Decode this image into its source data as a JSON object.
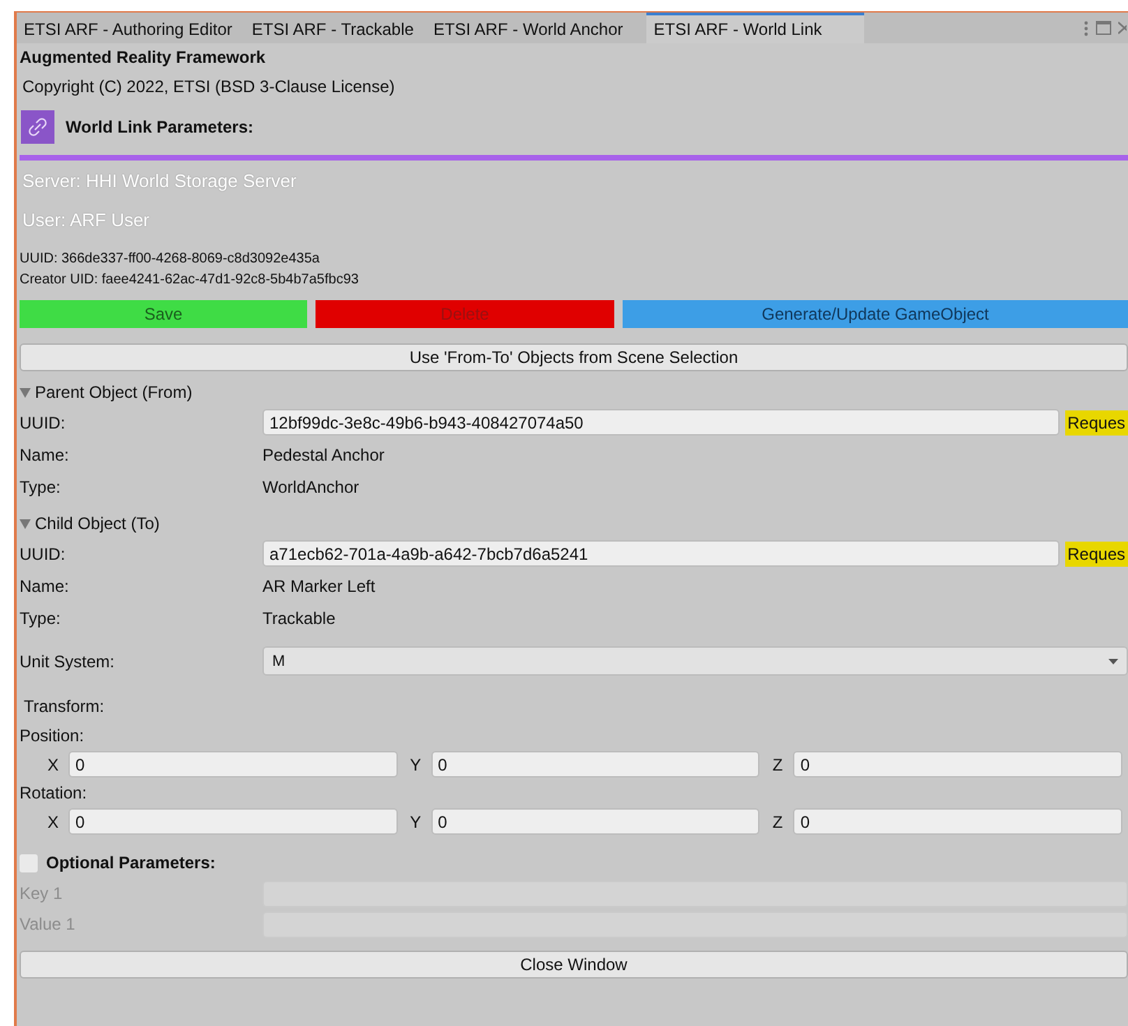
{
  "tabs": [
    {
      "label": "ETSI ARF - Authoring Editor",
      "selected": false
    },
    {
      "label": "ETSI ARF - Trackable",
      "selected": false
    },
    {
      "label": "ETSI ARF - World Anchor",
      "selected": false
    },
    {
      "label": "ETSI ARF - World Link",
      "selected": true
    }
  ],
  "title": "Augmented Reality Framework",
  "copyright": "Copyright (C) 2022, ETSI (BSD 3-Clause License)",
  "header": "World Link Parameters:",
  "server": "Server: HHI World Storage Server",
  "user": "User: ARF User",
  "uuid": "UUID: 366de337-ff00-4268-8069-c8d3092e435a",
  "creator_uid": "Creator UID: faee4241-62ac-47d1-92c8-5b4b7a5fbc93",
  "actions": [
    {
      "label": "Save",
      "kind": "save"
    },
    {
      "label": "Delete",
      "kind": "delete"
    },
    {
      "label": "Generate/Update GameObject",
      "kind": "generate"
    }
  ],
  "scene_button": "Use 'From-To' Objects from Scene Selection",
  "objects": [
    {
      "title": "Parent Object (From)",
      "expanded": true,
      "uuid_label": "UUID:",
      "uuid": "12bf99dc-3e8c-49b6-b943-408427074a50",
      "request": "Reques",
      "name_label": "Name:",
      "name": "Pedestal Anchor",
      "type_label": "Type:",
      "type": "WorldAnchor"
    },
    {
      "title": "Child Object (To)",
      "expanded": true,
      "uuid_label": "UUID:",
      "uuid": "a71ecb62-701a-4a9b-a642-7bcb7d6a5241",
      "request": "Reques",
      "name_label": "Name:",
      "name": "AR Marker Left",
      "type_label": "Type:",
      "type": "Trackable"
    }
  ],
  "unit_system": {
    "label": "Unit System:",
    "value": "M"
  },
  "transform": "Transform:",
  "vectors": [
    {
      "label": "Position:",
      "fields": [
        {
          "axis": "X",
          "value": "0"
        },
        {
          "axis": "Y",
          "value": "0"
        },
        {
          "axis": "Z",
          "value": "0"
        }
      ]
    },
    {
      "label": "Rotation:",
      "fields": [
        {
          "axis": "X",
          "value": "0"
        },
        {
          "axis": "Y",
          "value": "0"
        },
        {
          "axis": "Z",
          "value": "0"
        }
      ]
    }
  ],
  "optional": {
    "label": "Optional Parameters:",
    "checked": false,
    "rows": [
      {
        "label": "Key 1",
        "disabled": true
      },
      {
        "label": "Value 1",
        "disabled": true
      }
    ]
  },
  "close_button": "Close Window"
}
